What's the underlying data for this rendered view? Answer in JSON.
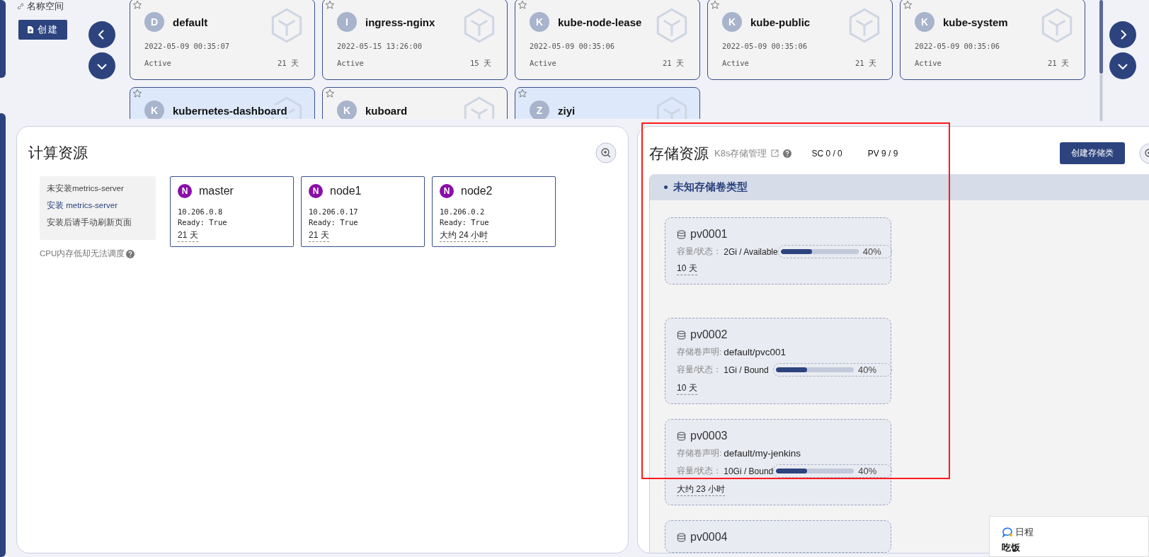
{
  "namespace_nav": {
    "title": "名称空间",
    "create_button": "创建"
  },
  "namespaces": [
    {
      "avatar": "D",
      "name": "default",
      "created": "2022-05-09 00:35:07",
      "status": "Active",
      "age": "21 天",
      "selected": false
    },
    {
      "avatar": "I",
      "name": "ingress-nginx",
      "created": "2022-05-15 13:26:00",
      "status": "Active",
      "age": "15 天",
      "selected": false
    },
    {
      "avatar": "K",
      "name": "kube-node-lease",
      "created": "2022-05-09 00:35:06",
      "status": "Active",
      "age": "21 天",
      "selected": false
    },
    {
      "avatar": "K",
      "name": "kube-public",
      "created": "2022-05-09 00:35:06",
      "status": "Active",
      "age": "21 天",
      "selected": false
    },
    {
      "avatar": "K",
      "name": "kube-system",
      "created": "2022-05-09 00:35:06",
      "status": "Active",
      "age": "21 天",
      "selected": false
    },
    {
      "avatar": "K",
      "name": "kubernetes-dashboard",
      "selected": true
    },
    {
      "avatar": "K",
      "name": "kuboard",
      "selected": false
    },
    {
      "avatar": "Z",
      "name": "ziyi",
      "selected": true
    }
  ],
  "compute": {
    "title": "计算资源",
    "notice": [
      "未安装metrics-server",
      "安装 metrics-server",
      "安装后请手动刷新页面"
    ],
    "hint": "CPU内存低却无法调度",
    "nodes": [
      {
        "badge": "N",
        "name": "master",
        "ip": "10.206.0.8",
        "ready": "Ready: True",
        "age": "21 天"
      },
      {
        "badge": "N",
        "name": "node1",
        "ip": "10.206.0.17",
        "ready": "Ready: True",
        "age": "21 天"
      },
      {
        "badge": "N",
        "name": "node2",
        "ip": "10.206.0.2",
        "ready": "Ready: True",
        "age": "大约 24 小时"
      }
    ]
  },
  "storage": {
    "title": "存储资源",
    "link": "K8s存储管理",
    "sc": "SC 0 / 0",
    "pv": "PV 9 / 9",
    "create_button": "创建存储类",
    "group": "未知存储卷类型",
    "volumes": [
      {
        "name": "pv0001",
        "capacity_label": "容量/状态：",
        "capacity": "2Gi / Available",
        "level": 0.4,
        "percent": "40%",
        "age": "10 天"
      },
      {
        "name": "pv0002",
        "claim_label": "存储卷声明:",
        "claim": "default/pvc001",
        "capacity_label": "容量/状态：",
        "capacity": "1Gi / Bound",
        "level": 0.4,
        "percent": "40%",
        "age": "10 天"
      },
      {
        "name": "pv0003",
        "claim_label": "存储卷声明:",
        "claim": "default/my-jenkins",
        "capacity_label": "容量/状态：",
        "capacity": "10Gi / Bound",
        "level": 0.4,
        "percent": "40%",
        "age": "大约 23 小时"
      },
      {
        "name": "pv0004"
      }
    ]
  },
  "annotation": {
    "kind": "rectangle"
  },
  "notification": {
    "app": "日程",
    "title": "吃饭"
  }
}
